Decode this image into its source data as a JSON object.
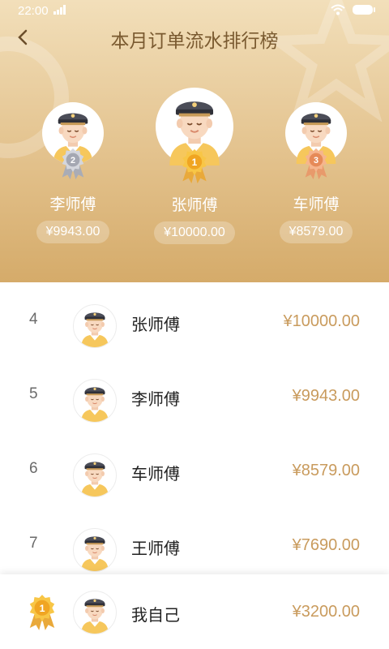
{
  "status_bar": {
    "time": "22:00"
  },
  "header": {
    "title": "本月订单流水排行榜"
  },
  "colors": {
    "gold": "#c99b5d",
    "hero_top": "#f2dfba",
    "hero_bottom": "#d5ab6a"
  },
  "podium": [
    {
      "rank": "2",
      "name": "李师傅",
      "amount": "¥9943.00",
      "medal": "silver"
    },
    {
      "rank": "1",
      "name": "张师傅",
      "amount": "¥10000.00",
      "medal": "gold"
    },
    {
      "rank": "3",
      "name": "车师傅",
      "amount": "¥8579.00",
      "medal": "bronze"
    }
  ],
  "ranking": [
    {
      "rank": "4",
      "name": "张师傅",
      "amount": "¥10000.00"
    },
    {
      "rank": "5",
      "name": "李师傅",
      "amount": "¥9943.00"
    },
    {
      "rank": "6",
      "name": "车师傅",
      "amount": "¥8579.00"
    },
    {
      "rank": "7",
      "name": "王师傅",
      "amount": "¥7690.00"
    }
  ],
  "self": {
    "rank": "1",
    "name": "我自己",
    "amount": "¥3200.00"
  }
}
